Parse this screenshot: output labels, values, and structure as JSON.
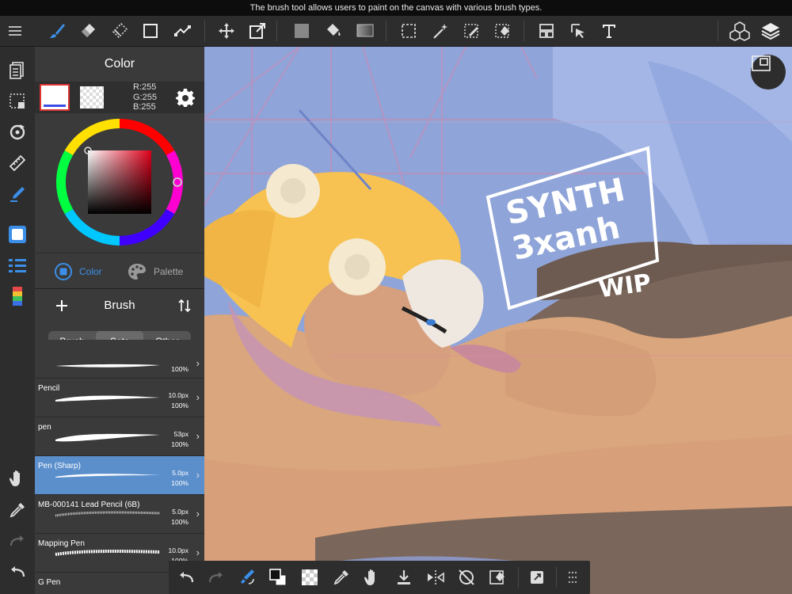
{
  "status_bar": {
    "text": "The brush tool allows users to paint on the canvas with various brush types."
  },
  "color_panel": {
    "title": "Color",
    "rgb": {
      "r": "R:255",
      "g": "G:255",
      "b": "B:255"
    },
    "tabs": [
      {
        "label": "Color",
        "active": true
      },
      {
        "label": "Palette",
        "active": false
      }
    ]
  },
  "brush_panel": {
    "title": "Brush",
    "segments": [
      {
        "label": "Brush"
      },
      {
        "label": "Sets",
        "active": true
      },
      {
        "label": "Other"
      }
    ],
    "brushes": [
      {
        "name": "",
        "size": "",
        "opacity": "100%"
      },
      {
        "name": "Pencil",
        "size": "10.0px",
        "opacity": "100%"
      },
      {
        "name": "pen",
        "size": "53px",
        "opacity": "100%"
      },
      {
        "name": "Pen (Sharp)",
        "size": "5.0px",
        "opacity": "100%",
        "selected": true
      },
      {
        "name": "MB-000141 Lead Pencil (6B)",
        "size": "5.0px",
        "opacity": "100%"
      },
      {
        "name": "Mapping Pen",
        "size": "10.0px",
        "opacity": "100%"
      },
      {
        "name": "G Pen",
        "size": "",
        "opacity": ""
      }
    ]
  },
  "canvas": {
    "watermark_lines": [
      "SYNTH",
      "3xanh",
      "WIP"
    ]
  },
  "colors": {
    "accent": "#3b8fe8",
    "selected_row": "#5b8fcc",
    "panel_bg": "#3a3a3a",
    "toolbar_bg": "#2d2d2d"
  }
}
